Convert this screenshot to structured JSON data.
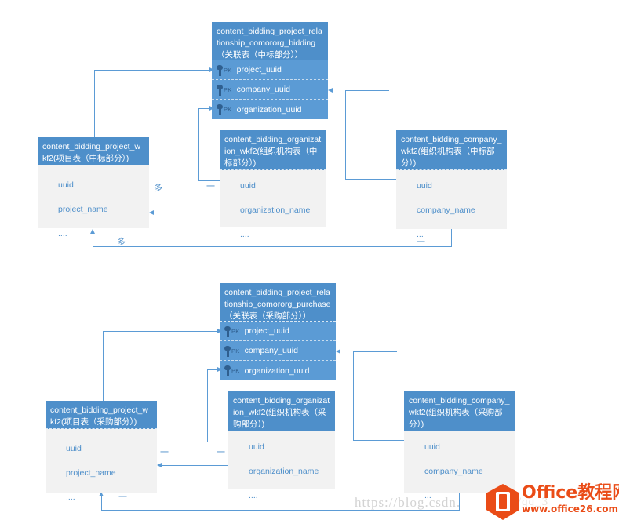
{
  "diagram": {
    "title": "",
    "accent_color": "#5b9bd5",
    "header_color": "#4e8fca",
    "body_color": "#f2f2f2",
    "pk_label": "PK"
  },
  "entities": [
    {
      "id": "rel_bidding",
      "header": "content_bidding_project_relationship_comororg_bidding（关联表（中标部分））",
      "rows": [
        {
          "pk": "PK",
          "name": "project_uuid"
        },
        {
          "pk": "PK",
          "name": "company_uuid"
        },
        {
          "pk": "PK",
          "name": "organization_uuid"
        }
      ]
    },
    {
      "id": "project_bidding",
      "header": "content_bidding_project_wkf2(项目表（中标部分）)",
      "rows": [
        {
          "name": "uuid"
        },
        {
          "name": "project_name"
        },
        {
          "name": "...."
        }
      ]
    },
    {
      "id": "organization_bidding",
      "header": "content_bidding_organization_wkf2(组织机构表（中标部分）)",
      "rows": [
        {
          "name": "uuid"
        },
        {
          "name": "organization_name"
        },
        {
          "name": "...."
        }
      ]
    },
    {
      "id": "company_bidding",
      "header": "content_bidding_company_wkf2(组织机构表（中标部分）)",
      "rows": [
        {
          "name": "uuid"
        },
        {
          "name": "company_name"
        },
        {
          "name": "..."
        }
      ]
    },
    {
      "id": "rel_purchase",
      "header": "content_bidding_project_relationship_comororg_purchase（关联表（采购部分））",
      "rows": [
        {
          "pk": "PK",
          "name": "project_uuid"
        },
        {
          "pk": "PK",
          "name": "company_uuid"
        },
        {
          "pk": "PK",
          "name": "organization_uuid"
        }
      ]
    },
    {
      "id": "project_purchase",
      "header": "content_bidding_project_wkf2(项目表（采购部分）)",
      "rows": [
        {
          "name": "uuid"
        },
        {
          "name": "project_name"
        },
        {
          "name": "...."
        }
      ]
    },
    {
      "id": "organization_purchase",
      "header": "content_bidding_organization_wkf2(组织机构表（采购部分）)",
      "rows": [
        {
          "name": "uuid"
        },
        {
          "name": "organization_name"
        },
        {
          "name": "...."
        }
      ]
    },
    {
      "id": "company_purchase",
      "header": "content_bidding_company_wkf2(组织机构表（采购部分）)",
      "rows": [
        {
          "name": "uuid"
        },
        {
          "name": "company_name"
        },
        {
          "name": "..."
        }
      ]
    }
  ],
  "cardinalities": [
    {
      "id": "c1",
      "label": "多"
    },
    {
      "id": "c2",
      "label": "一"
    },
    {
      "id": "c3",
      "label": "多"
    },
    {
      "id": "c4",
      "label": "一"
    },
    {
      "id": "c5",
      "label": "一"
    },
    {
      "id": "c6",
      "label": "一"
    },
    {
      "id": "c7",
      "label": "一"
    }
  ],
  "watermark": {
    "url": "https://blog.csdn.",
    "qq": "/qq_3",
    "logo_title": "Office教程网",
    "logo_site": "www.office26.com"
  }
}
